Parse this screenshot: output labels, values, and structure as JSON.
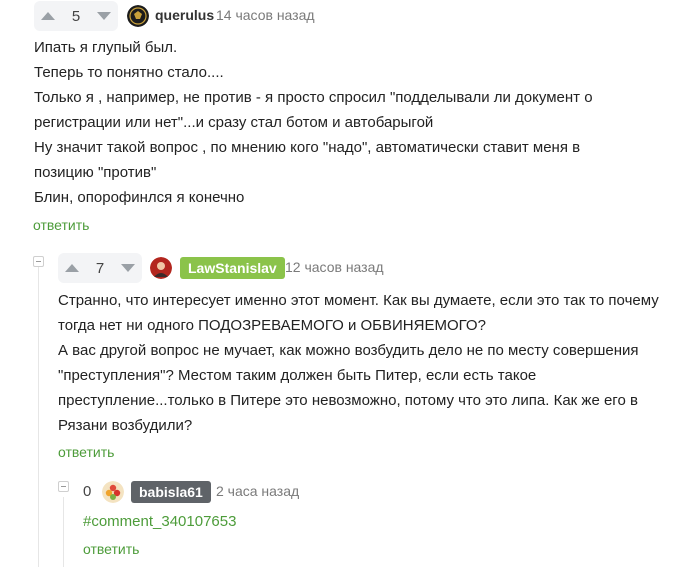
{
  "colors": {
    "accent_green": "#4d9c3a",
    "badge_green": "#8bc34a",
    "badge_gray": "#5f6368",
    "vote_bg": "#f3f4f6"
  },
  "comments": [
    {
      "rating": "5",
      "username": "querulus",
      "time": "14 часов назад",
      "avatar_icon": "avatar-dark-emblem-icon",
      "lines": [
        "Ипать я глупый был.",
        "Теперь то понятно стало....",
        "Только я , например, не против - я просто спросил \"подделывали ли документ о",
        "регистрации или нет\"...и сразу стал ботом и автобарыгой",
        "Ну значит такой вопрос , по мнению кого \"надо\", автоматически ставит меня в",
        "позицию \"против\"",
        "Блин, опорофинлся я конечно"
      ],
      "reply_label": "ответить"
    },
    {
      "rating": "7",
      "username": "LawStanislav",
      "time": "12 часов назад",
      "avatar_icon": "avatar-red-portrait-icon",
      "lines": [
        "Странно, что интересует именно этот момент. Как вы думаете, если это так то почему",
        "тогда нет ни одного ПОДОЗРЕВАЕМОГО и ОБВИНЯЕМОГО?",
        "А вас другой вопрос не мучает, как можно возбудить дело не по месту совершения",
        "\"преступления\"? Местом таким должен быть Питер, если есть такое",
        "преступление...только в Питере это невозможно, потому что это липа. Как же его в",
        "Рязани возбудили?"
      ],
      "reply_label": "ответить"
    },
    {
      "rating": "0",
      "username": "babisla61",
      "time": "2 часа назад",
      "avatar_icon": "avatar-floral-icon",
      "link_text": "#comment_340107653",
      "reply_label": "ответить"
    }
  ]
}
